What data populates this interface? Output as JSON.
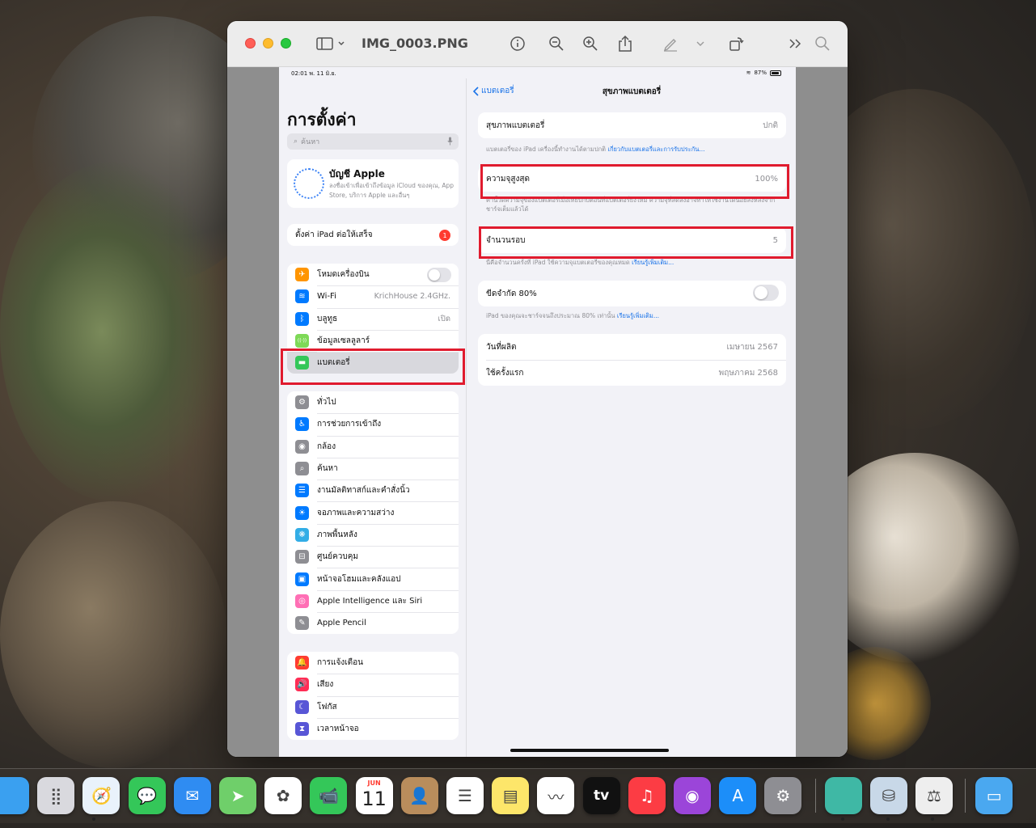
{
  "window": {
    "file_name": "IMG_0003.PNG"
  },
  "ipad": {
    "status_time": "02:01",
    "status_date": "พ. 11 มิ.ย.",
    "status_battery": "87%",
    "sidebar": {
      "title": "การตั้งค่า",
      "search_placeholder": "ค้นหา",
      "apple_title": "บัญชี Apple",
      "apple_subtitle": "ลงชื่อเข้าเพื่อเข้าถึงข้อมูล iCloud ของคุณ, App Store, บริการ Apple และอื่นๆ",
      "setup_label": "ตั้งค่า iPad ต่อให้เสร็จ",
      "setup_badge": "1",
      "group1": [
        {
          "label": "โหมดเครื่องบิน",
          "value": "",
          "icon": "airplane-icon",
          "color": "#ff9500",
          "glyph": "✈"
        },
        {
          "label": "Wi-Fi",
          "value": "KrichHouse 2.4GHz.",
          "icon": "wifi-icon",
          "color": "#007aff",
          "glyph": "≋"
        },
        {
          "label": "บลูทูธ",
          "value": "เปิด",
          "icon": "bluetooth-icon",
          "color": "#007aff",
          "glyph": "ᛒ"
        },
        {
          "label": "ข้อมูลเซลลูลาร์",
          "value": "",
          "icon": "cellular-icon",
          "color": "#7ed957",
          "glyph": "((·))"
        },
        {
          "label": "แบตเตอรี่",
          "value": "",
          "icon": "battery-icon",
          "color": "#34c759",
          "glyph": "▬"
        }
      ],
      "group2": [
        {
          "label": "ทั่วไป",
          "icon": "gear-icon",
          "color": "#8e8e93",
          "glyph": "⚙"
        },
        {
          "label": "การช่วยการเข้าถึง",
          "icon": "accessibility-icon",
          "color": "#007aff",
          "glyph": "♿"
        },
        {
          "label": "กล้อง",
          "icon": "camera-icon",
          "color": "#8e8e93",
          "glyph": "◉"
        },
        {
          "label": "ค้นหา",
          "icon": "search-icon",
          "color": "#8e8e93",
          "glyph": "⌕"
        },
        {
          "label": "งานมัลติทาสก์และคำสั่งนิ้ว",
          "icon": "multitasking-icon",
          "color": "#007aff",
          "glyph": "☰"
        },
        {
          "label": "จอภาพและความสว่าง",
          "icon": "brightness-icon",
          "color": "#007aff",
          "glyph": "☀"
        },
        {
          "label": "ภาพพื้นหลัง",
          "icon": "wallpaper-icon",
          "color": "#32ade6",
          "glyph": "❋"
        },
        {
          "label": "ศูนย์ควบคุม",
          "icon": "control-center-icon",
          "color": "#8e8e93",
          "glyph": "⊟"
        },
        {
          "label": "หน้าจอโฮมและคลังแอป",
          "icon": "home-screen-icon",
          "color": "#007aff",
          "glyph": "▣"
        },
        {
          "label": "Apple Intelligence และ Siri",
          "icon": "siri-icon",
          "color": "#ff6fb5",
          "glyph": "◎"
        },
        {
          "label": "Apple Pencil",
          "icon": "pencil-icon",
          "color": "#8e8e93",
          "glyph": "✎"
        }
      ],
      "group3": [
        {
          "label": "การแจ้งเตือน",
          "icon": "notification-icon",
          "color": "#ff3b30",
          "glyph": "🔔"
        },
        {
          "label": "เสียง",
          "icon": "sound-icon",
          "color": "#ff2d55",
          "glyph": "🔊"
        },
        {
          "label": "โฟกัส",
          "icon": "focus-icon",
          "color": "#5856d6",
          "glyph": "☾"
        },
        {
          "label": "เวลาหน้าจอ",
          "icon": "screen-time-icon",
          "color": "#5856d6",
          "glyph": "⧗"
        }
      ]
    },
    "main": {
      "back_label": "แบตเตอรี่",
      "title": "สุขภาพแบตเตอรี่",
      "health_label": "สุขภาพแบตเตอรี่",
      "health_value": "ปกติ",
      "health_note": "แบตเตอรี่ของ iPad เครื่องนี้ทำงานได้ตามปกติ",
      "health_link": "เกี่ยวกับแบตเตอรี่และการรับประกัน...",
      "max_label": "ความจุสูงสุด",
      "max_value": "100%",
      "max_note": "ค่านี้วัดความจุของแบตเตอรี่เมื่อเทียบกับตอนที่แบตเตอรี่ยังใหม่ ความจุที่ลดลงอาจทำให้ใช้งานได้น้อยลงหลังจากชาร์จเต็มแล้วได้",
      "cycle_label": "จำนวนรอบ",
      "cycle_value": "5",
      "cycle_note": "นี่คือจำนวนครั้งที่ iPad ใช้ความจุแบตเตอรี่ของคุณหมด",
      "cycle_link": "เรียนรู้เพิ่มเติม...",
      "limit_label": "ขีดจำกัด 80%",
      "limit_note": "iPad ของคุณจะชาร์จจนถึงประมาณ 80% เท่านั้น",
      "limit_link": "เรียนรู้เพิ่มเติม...",
      "manufacture_label": "วันที่ผลิต",
      "manufacture_value": "เมษายน 2567",
      "first_use_label": "ใช้ครั้งแรก",
      "first_use_value": "พฤษภาคม 2568"
    }
  },
  "dock": {
    "calendar_month": "JUN",
    "calendar_day": "11",
    "tv_label": "tv",
    "apps": [
      {
        "name": "finder-icon",
        "color": "#3aa0f0",
        "glyph": ""
      },
      {
        "name": "launchpad-icon",
        "color": "#d9d9de",
        "glyph": "⣿"
      },
      {
        "name": "safari-icon",
        "color": "#e9f2fb",
        "glyph": "🧭"
      },
      {
        "name": "messages-icon",
        "color": "#34c759",
        "glyph": "💬"
      },
      {
        "name": "mail-icon",
        "color": "#2f8cf2",
        "glyph": "✉"
      },
      {
        "name": "maps-icon",
        "color": "#6fcf6a",
        "glyph": "➤"
      },
      {
        "name": "photos-icon",
        "color": "#ffffff",
        "glyph": "✿"
      },
      {
        "name": "facetime-icon",
        "color": "#34c759",
        "glyph": "📹"
      },
      {
        "name": "calendar-icon",
        "color": "#ffffff",
        "glyph": ""
      },
      {
        "name": "contacts-icon",
        "color": "#b98d5c",
        "glyph": "👤"
      },
      {
        "name": "reminders-icon",
        "color": "#ffffff",
        "glyph": "☰"
      },
      {
        "name": "notes-icon",
        "color": "#fde66a",
        "glyph": "▤"
      },
      {
        "name": "freeform-icon",
        "color": "#ffffff",
        "glyph": "〰"
      },
      {
        "name": "apple-tv-icon",
        "color": "#111111",
        "glyph": ""
      },
      {
        "name": "music-icon",
        "color": "#fc3c44",
        "glyph": "♫"
      },
      {
        "name": "podcasts-icon",
        "color": "#9b45d9",
        "glyph": "◉"
      },
      {
        "name": "app-store-icon",
        "color": "#1c8ef9",
        "glyph": "A"
      },
      {
        "name": "system-settings-icon",
        "color": "#8e8e93",
        "glyph": "⚙"
      },
      {
        "name": "plugin-scan-icon",
        "color": "#3fb8a5",
        "glyph": ""
      },
      {
        "name": "disk-utility-icon",
        "color": "#c8d8e8",
        "glyph": "⛁"
      },
      {
        "name": "archive-utility-icon",
        "color": "#eeeeee",
        "glyph": "⚖"
      },
      {
        "name": "downloads-folder-icon",
        "color": "#4aa8f0",
        "glyph": "▭"
      }
    ]
  }
}
